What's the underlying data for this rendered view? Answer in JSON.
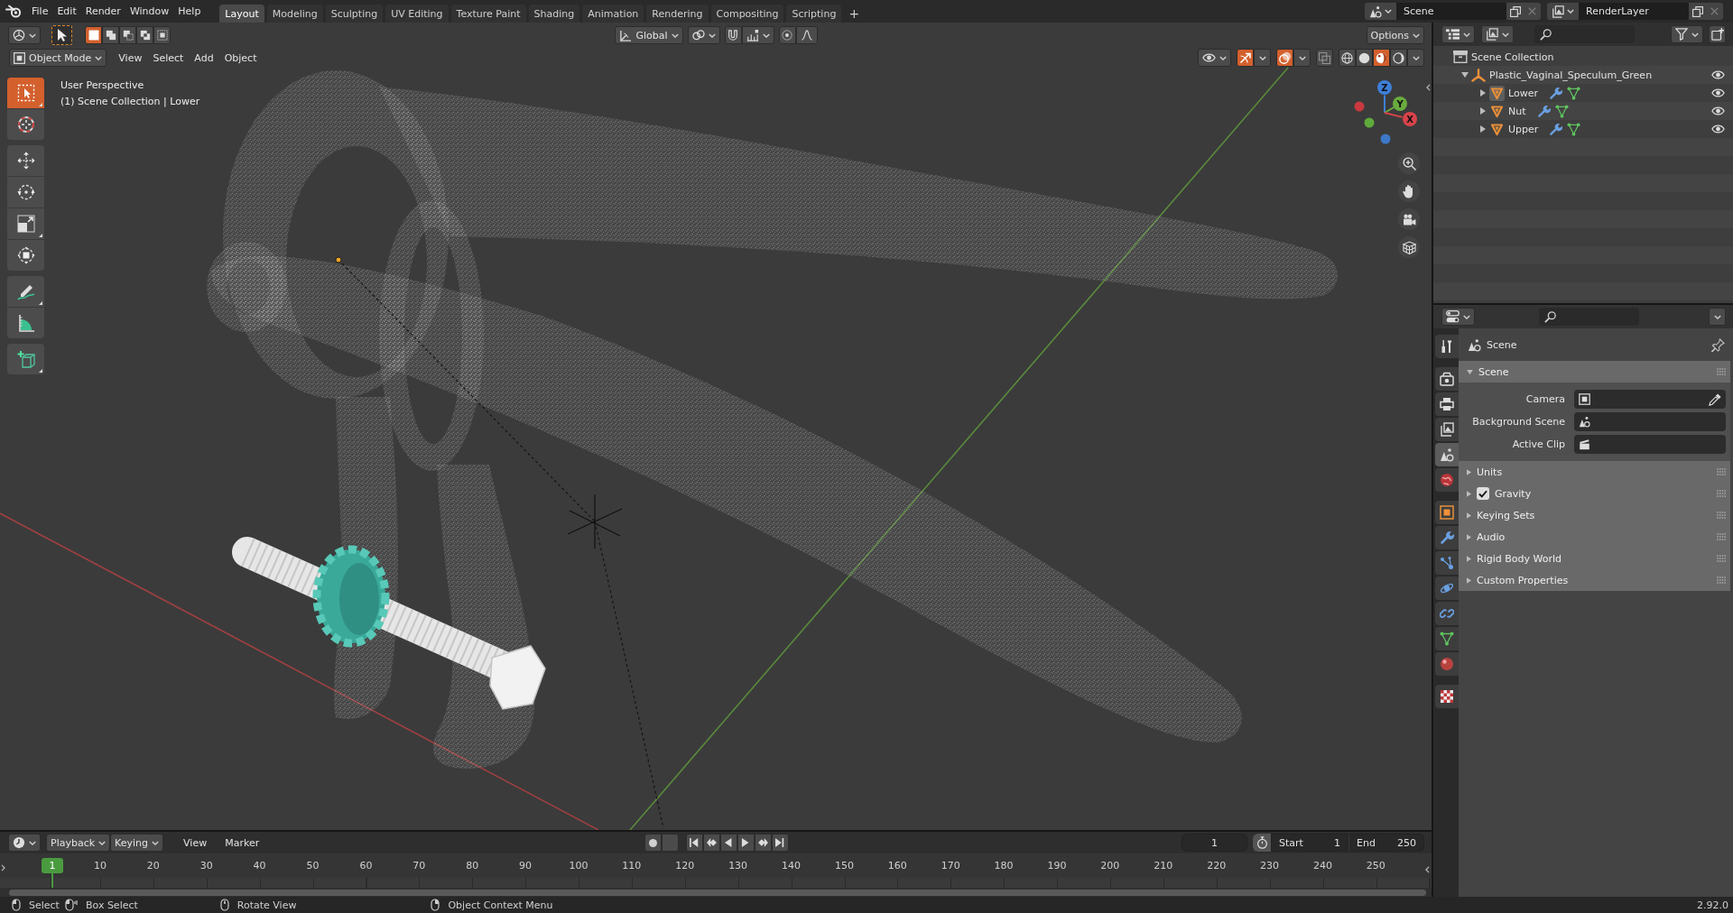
{
  "top_bar": {
    "menus": [
      "File",
      "Edit",
      "Render",
      "Window",
      "Help"
    ],
    "workspaces": [
      {
        "label": "Layout",
        "selected": true
      },
      {
        "label": "Modeling",
        "selected": false
      },
      {
        "label": "Sculpting",
        "selected": false
      },
      {
        "label": "UV Editing",
        "selected": false
      },
      {
        "label": "Texture Paint",
        "selected": false
      },
      {
        "label": "Shading",
        "selected": false
      },
      {
        "label": "Animation",
        "selected": false
      },
      {
        "label": "Rendering",
        "selected": false
      },
      {
        "label": "Compositing",
        "selected": false
      },
      {
        "label": "Scripting",
        "selected": false
      }
    ],
    "add_tab": "+",
    "scene": "Scene",
    "view_layer": "RenderLayer"
  },
  "viewport": {
    "select_modes": [
      {
        "selected": true
      },
      {
        "selected": false
      },
      {
        "selected": false
      },
      {
        "selected": false
      },
      {
        "selected": false
      }
    ],
    "orientation": "Global",
    "options": "Options",
    "mode": "Object Mode",
    "menus": [
      "View",
      "Select",
      "Add",
      "Object"
    ],
    "toggles": [
      {
        "kind": "gizmos",
        "on": true
      },
      {
        "kind": "overlays",
        "on": true
      },
      {
        "kind": "xray",
        "on": false
      }
    ],
    "shading": [
      {
        "selected": false
      },
      {
        "selected": false
      },
      {
        "selected": true
      },
      {
        "selected": false
      }
    ],
    "info": [
      "User Perspective",
      "(1) Scene Collection | Lower"
    ],
    "tools": [
      {
        "selected": true
      },
      {
        "selected": false
      },
      {
        "selected": false
      },
      {
        "selected": false
      },
      {
        "selected": false
      },
      {
        "selected": false
      },
      {
        "selected": false
      },
      {
        "selected": false
      },
      {
        "selected": false
      }
    ],
    "gizmo_axes": [
      "Z",
      "Y",
      "X"
    ]
  },
  "outliner": {
    "tree": [
      {
        "kind": "collection",
        "label": "Scene Collection",
        "children": [
          {
            "kind": "empty",
            "label": "Plastic_Vaginal_Speculum_Green",
            "expanded": true,
            "visible": true,
            "children": [
              {
                "kind": "mesh",
                "label": "Lower",
                "expanded": false,
                "visible": true,
                "active": true
              },
              {
                "kind": "mesh",
                "label": "Nut",
                "expanded": false,
                "visible": true,
                "active": false
              },
              {
                "kind": "mesh",
                "label": "Upper",
                "expanded": false,
                "visible": true,
                "active": false
              }
            ]
          }
        ]
      }
    ]
  },
  "properties": {
    "tabs": [
      {
        "selected": false
      },
      {
        "selected": false
      },
      {
        "selected": false
      },
      {
        "selected": false
      },
      {
        "selected": true
      },
      {
        "selected": false
      },
      {
        "selected": false
      },
      {
        "selected": false
      },
      {
        "selected": false
      },
      {
        "selected": false
      },
      {
        "selected": false
      },
      {
        "selected": false
      },
      {
        "selected": false
      },
      {
        "selected": false
      }
    ],
    "context": "Scene",
    "panels": [
      {
        "kind": "panel",
        "title": "Scene",
        "expanded": true,
        "fields": [
          "Camera",
          "Background Scene",
          "Active Clip"
        ]
      },
      {
        "kind": "panel",
        "title": "Units",
        "expanded": false
      },
      {
        "kind": "toggle",
        "title": "Gravity",
        "expanded": false,
        "checked": true
      },
      {
        "kind": "panel",
        "title": "Keying Sets",
        "expanded": false
      },
      {
        "kind": "panel",
        "title": "Audio",
        "expanded": false
      },
      {
        "kind": "panel",
        "title": "Rigid Body World",
        "expanded": false
      },
      {
        "kind": "panel",
        "title": "Custom Properties",
        "expanded": false
      }
    ]
  },
  "timeline": {
    "menus": [
      {
        "kind": "dropdown",
        "label": "Playback"
      },
      {
        "kind": "dropdown",
        "label": "Keying"
      },
      {
        "kind": "menu",
        "label": "View"
      },
      {
        "kind": "menu",
        "label": "Marker"
      }
    ],
    "auto_keying": false,
    "current_frame": "1",
    "start_label": "Start",
    "start": "1",
    "end_label": "End",
    "end": "250",
    "playhead": "1",
    "ticks": [
      "10",
      "20",
      "30",
      "40",
      "50",
      "60",
      "70",
      "80",
      "90",
      "100",
      "110",
      "120",
      "130",
      "140",
      "150",
      "160",
      "170",
      "180",
      "190",
      "200",
      "210",
      "220",
      "230",
      "240",
      "250"
    ]
  },
  "status_bar": {
    "hints": [
      "Select",
      "Box Select",
      "Rotate View",
      "Object Context Menu"
    ],
    "version": "2.92.0"
  }
}
